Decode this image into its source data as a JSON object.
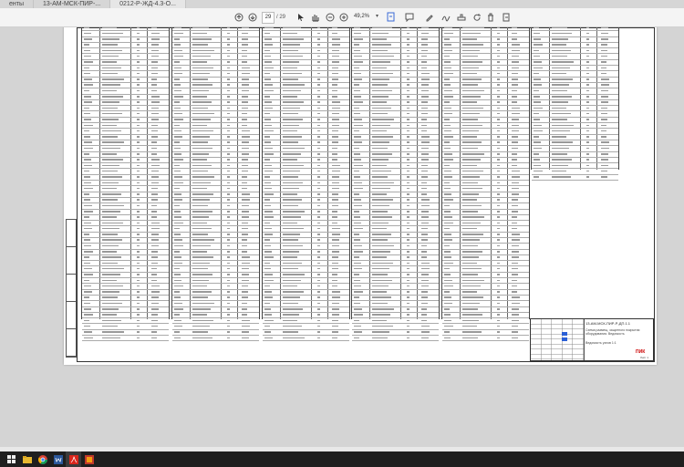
{
  "tabs": [
    {
      "label": "енты"
    },
    {
      "label": "13-АМ-МСК-ПИР-..."
    },
    {
      "label": "0212-Р-ЖД-4.3-О..."
    }
  ],
  "toolbar": {
    "page_current": "29",
    "page_separator": "/",
    "page_total": "29",
    "zoom": "49,2%",
    "zoom_dropdown": "▾"
  },
  "document": {
    "title_code": "13-АМ-МСК-ПИР-Р-ДП.1.1",
    "title_desc": "Схема размещ. защитного покрытия оборудования. Ведомость",
    "title_name": "Ведомость узлов 1:1",
    "company_logo": "ПИК",
    "sheet_label": "Лист 1",
    "section_labels": [
      "Узел 15",
      "Узел 16",
      "Узел 12",
      "Узел 13",
      "Узел 14",
      "Узел 1"
    ]
  },
  "taskbar": {
    "icons": [
      "windows-start-icon",
      "file-explorer-icon",
      "chrome-icon",
      "word-icon",
      "acrobat-icon",
      "file-manager-icon"
    ]
  }
}
